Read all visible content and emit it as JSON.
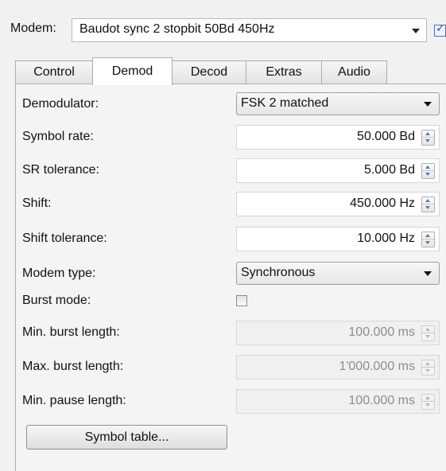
{
  "modem": {
    "label": "Modem:",
    "value": "Baudot sync 2 stopbit 50Bd 450Hz",
    "checkbox_checked": true
  },
  "tabs": [
    {
      "label": "Control",
      "active": false
    },
    {
      "label": "Demod",
      "active": true
    },
    {
      "label": "Decod",
      "active": false
    },
    {
      "label": "Extras",
      "active": false
    },
    {
      "label": "Audio",
      "active": false
    }
  ],
  "demod": {
    "demodulator": {
      "label": "Demodulator:",
      "value": "FSK 2 matched"
    },
    "symbol_rate": {
      "label": "Symbol rate:",
      "value": "50.000 Bd"
    },
    "sr_tolerance": {
      "label": "SR tolerance:",
      "value": "5.000 Bd"
    },
    "shift": {
      "label": "Shift:",
      "value": "450.000 Hz"
    },
    "shift_tolerance": {
      "label": "Shift tolerance:",
      "value": "10.000 Hz"
    },
    "modem_type": {
      "label": "Modem type:",
      "value": "Synchronous"
    },
    "burst_mode": {
      "label": "Burst mode:",
      "checked": false
    },
    "min_burst_length": {
      "label": "Min. burst length:",
      "value": "100.000 ms",
      "enabled": false
    },
    "max_burst_length": {
      "label": "Max. burst length:",
      "value": "1'000.000 ms",
      "enabled": false
    },
    "min_pause_length": {
      "label": "Min. pause length:",
      "value": "100.000 ms",
      "enabled": false
    },
    "symbol_table_button": "Symbol table..."
  }
}
